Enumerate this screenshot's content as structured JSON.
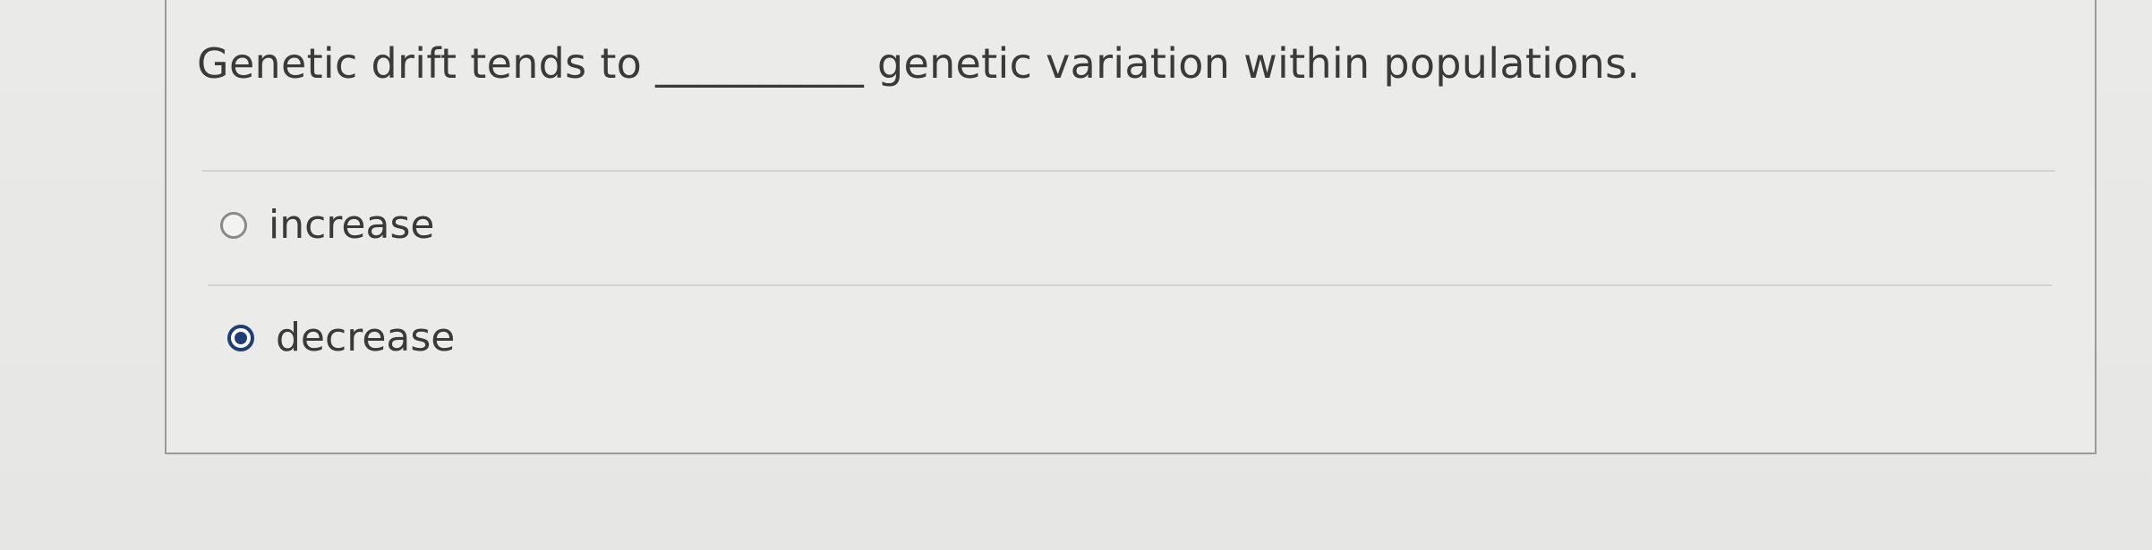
{
  "question": {
    "prefix": "Genetic drift tends to",
    "blank": "__________",
    "suffix": "genetic variation within populations."
  },
  "options": [
    {
      "label": "increase",
      "selected": false
    },
    {
      "label": "decrease",
      "selected": true
    }
  ],
  "colors": {
    "selected_radio": "#1f3f73",
    "text": "#3a3a3a",
    "card_border": "#9a9a98"
  }
}
